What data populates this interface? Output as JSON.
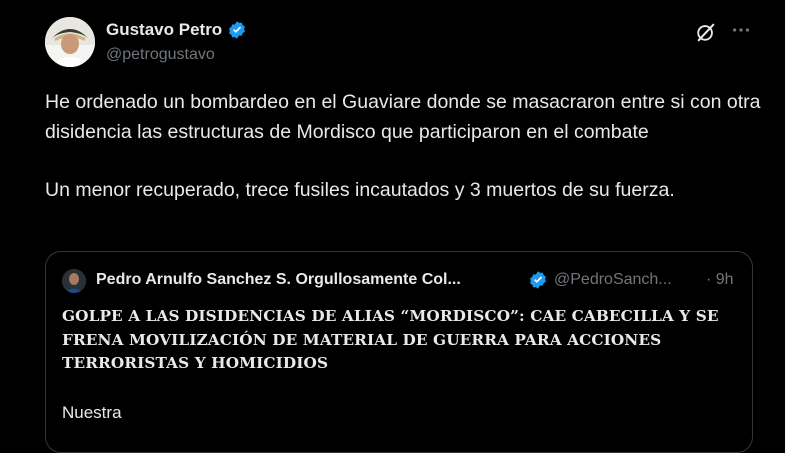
{
  "author": {
    "name": "Gustavo Petro",
    "handle": "@petrogustavo"
  },
  "tweet": {
    "paragraph1": "He ordenado un bombardeo en el Guaviare donde se masacraron entre si con otra disidencia las estructuras de Mordisco que participaron en el combate",
    "paragraph2": "Un menor recuperado, trece fusiles incautados y 3 muertos de su fuerza."
  },
  "quote": {
    "name": "Pedro Arnulfo Sanchez S. Orgullosamente Col...",
    "handle": "@PedroSanch...",
    "time": "· 9h",
    "headline": "GOLPE A LAS DISIDENCIAS DE ALIAS “MORDISCO”: CAE CABECILLA Y SE FRENA MOVILIZACIÓN DE MATERIAL DE GUERRA PARA ACCIONES TERRORISTAS Y HOMICIDIOS",
    "body_start": "Nuestra"
  },
  "colors": {
    "background": "#000000",
    "text": "#e7e9ea",
    "secondary": "#71767b",
    "verified": "#1d9bf0",
    "border": "#333639"
  },
  "icons": [
    "avatar",
    "verified-badge-icon",
    "grok-icon",
    "more-options-icon"
  ]
}
